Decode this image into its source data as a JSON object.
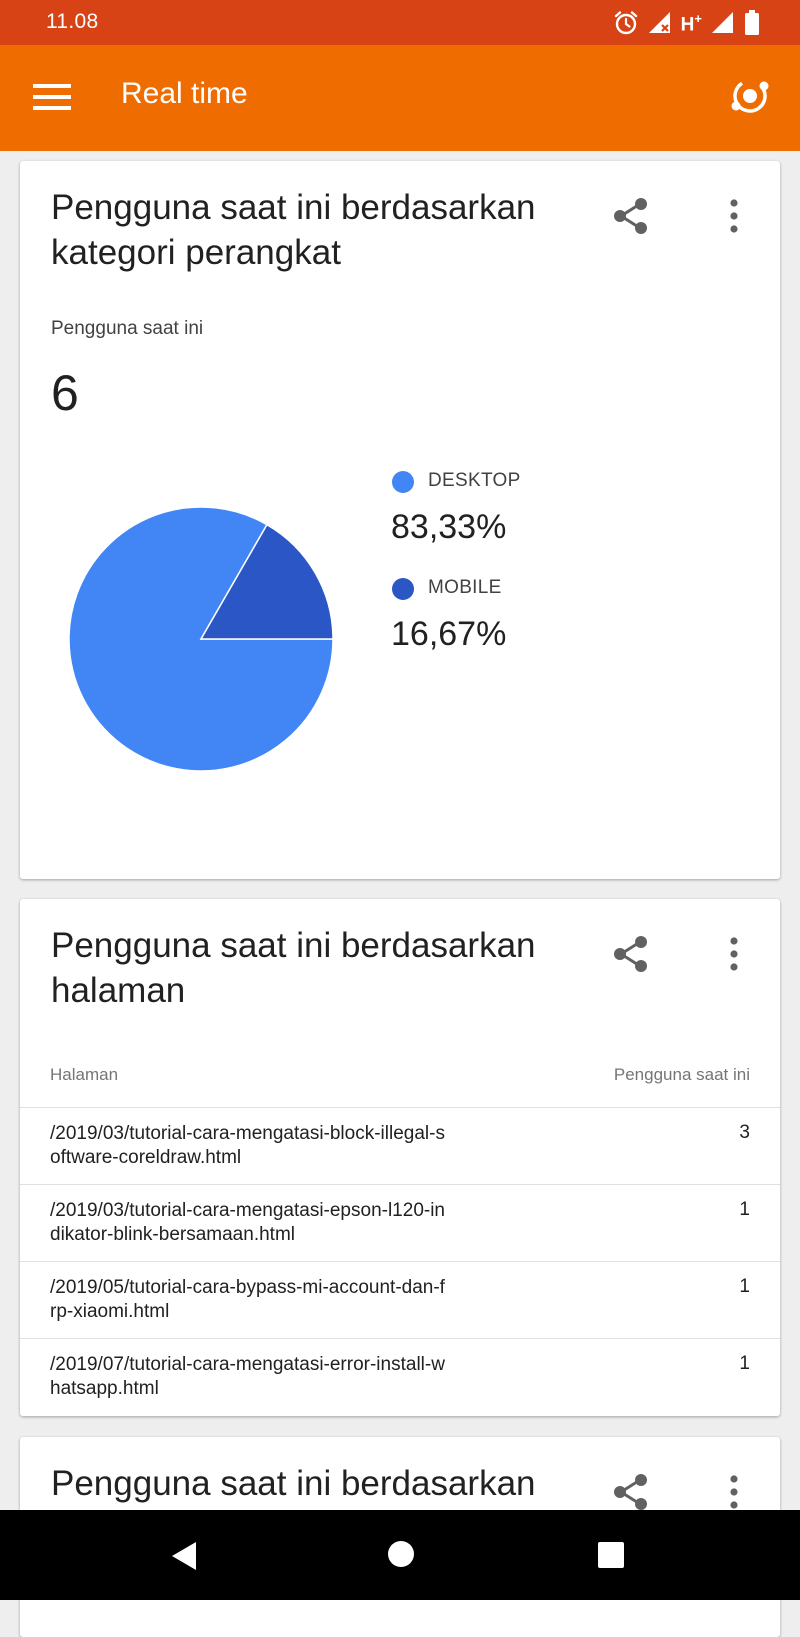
{
  "status_bar": {
    "time": "11.08",
    "network_label": "H",
    "network_suffix": "+",
    "icons": [
      "alarm-icon",
      "signal-no-sim-icon",
      "signal-icon",
      "battery-icon"
    ]
  },
  "app_bar": {
    "title": "Real time",
    "menu_icon": "menu-icon",
    "action_icon": "realtime-icon",
    "background": "#ef6c00",
    "status_background": "#d84315"
  },
  "device_card": {
    "title": "Pengguna saat ini berdasarkan kategori perangkat",
    "metric_label": "Pengguna saat ini",
    "metric_value": "6",
    "legend": [
      {
        "name": "DESKTOP",
        "value": "83,33%",
        "color": "#4285f4"
      },
      {
        "name": "MOBILE",
        "value": "16,67%",
        "color": "#2a56c6"
      }
    ]
  },
  "chart_data": {
    "type": "pie",
    "categories": [
      "DESKTOP",
      "MOBILE"
    ],
    "values": [
      83.33,
      16.67
    ],
    "colors": [
      "#4285f4",
      "#2a56c6"
    ],
    "legend": "right"
  },
  "pages_card": {
    "title": "Pengguna saat ini berdasarkan halaman",
    "columns": [
      "Halaman",
      "Pengguna saat ini"
    ],
    "rows": [
      {
        "page": "/2019/03/tutorial-cara-mengatasi-block-illegal-software-coreldraw.html",
        "users": "3"
      },
      {
        "page": "/2019/03/tutorial-cara-mengatasi-epson-l120-indikator-blink-bersamaan.html",
        "users": "1"
      },
      {
        "page": "/2019/05/tutorial-cara-bypass-mi-account-dan-frp-xiaomi.html",
        "users": "1"
      },
      {
        "page": "/2019/07/tutorial-cara-mengatasi-error-install-whatsapp.html",
        "users": "1"
      }
    ]
  },
  "third_card": {
    "title": "Pengguna saat ini berdasarkan"
  }
}
